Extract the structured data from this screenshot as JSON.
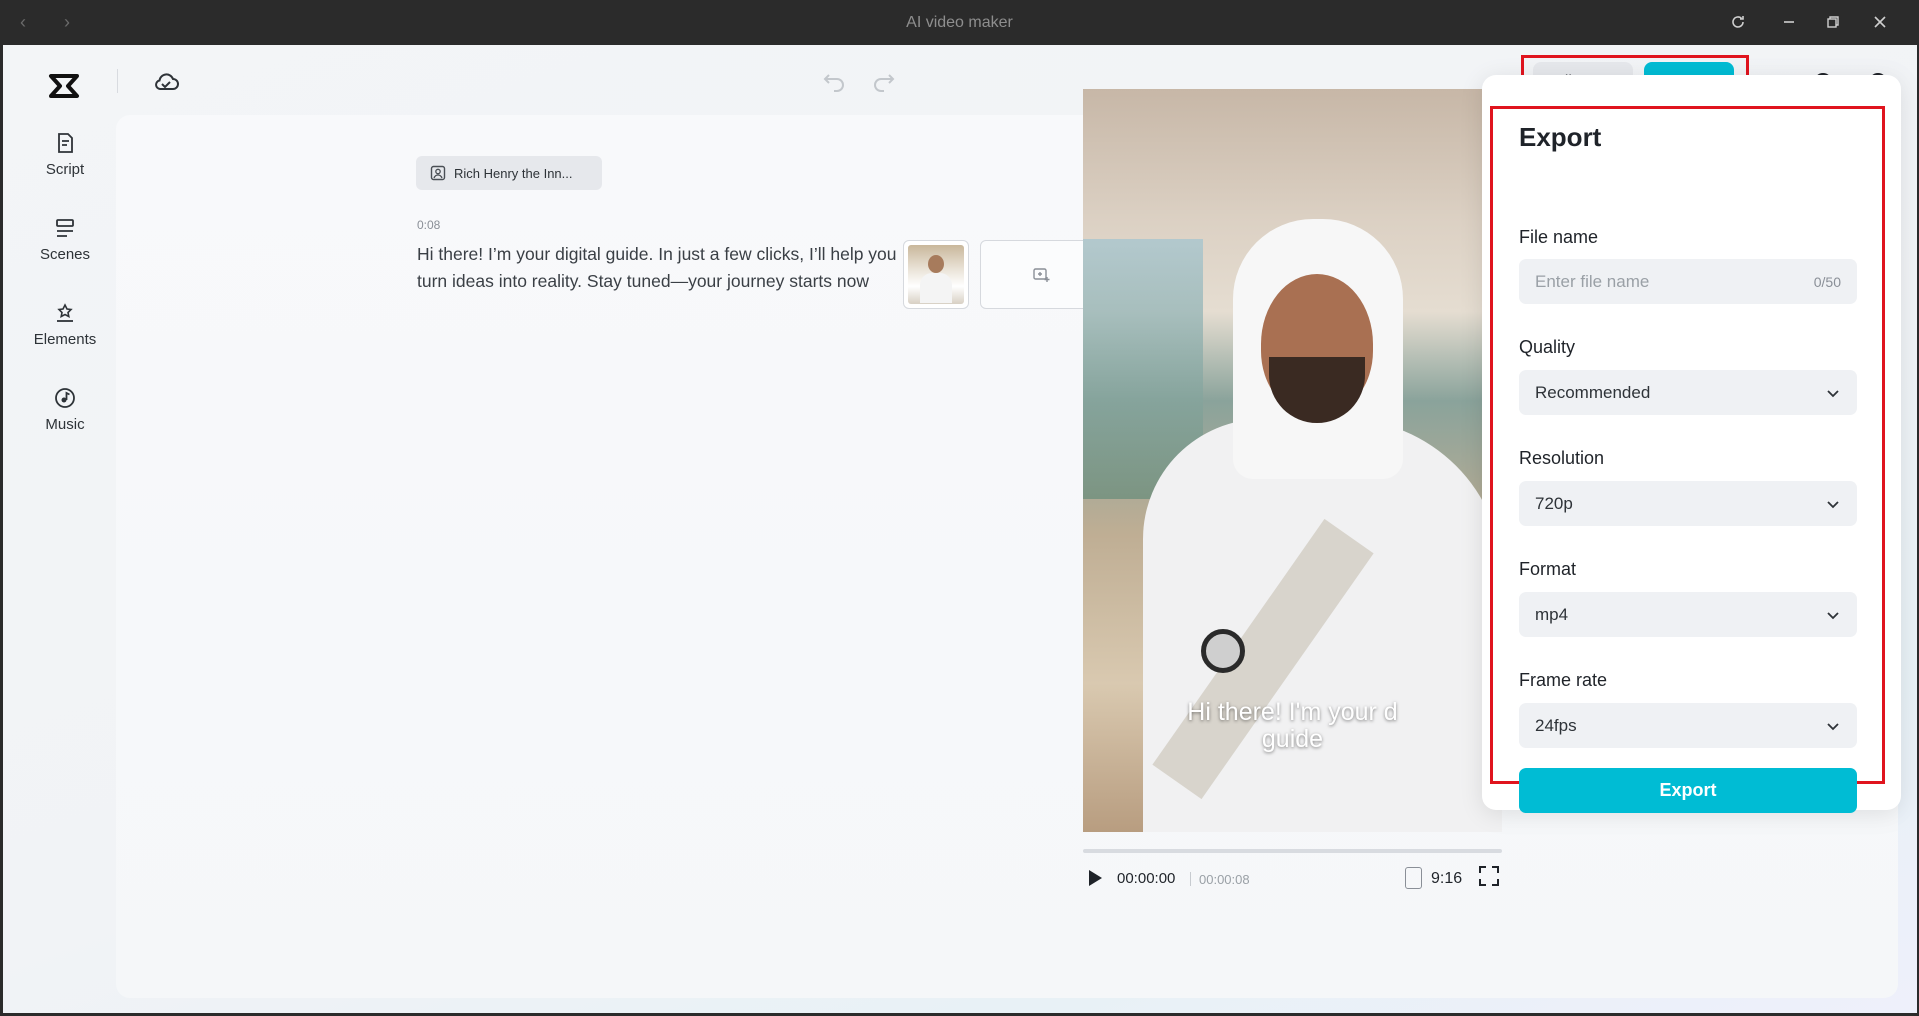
{
  "window": {
    "title": "AI video maker"
  },
  "toolbar": {
    "edit_more_label": "Edit more",
    "export_label": "Export"
  },
  "sidebar": {
    "items": [
      {
        "label": "Script",
        "icon": "script-icon"
      },
      {
        "label": "Scenes",
        "icon": "scenes-icon"
      },
      {
        "label": "Elements",
        "icon": "elements-icon"
      },
      {
        "label": "Music",
        "icon": "music-icon"
      }
    ]
  },
  "script": {
    "avatar_name": "Rich Henry the Inn...",
    "timecode": "0:08",
    "text": "Hi there! I’m your digital guide. In just a few clicks, I’ll help you turn ideas into reality. Stay tuned—your journey starts now"
  },
  "preview": {
    "subtitle_line1": "Hi there! I'm your d",
    "subtitle_line2": "guide",
    "current_time": "00:00:00",
    "total_time": "00:00:08",
    "aspect_ratio": "9:16",
    "progress_fraction": 0
  },
  "export_panel": {
    "title": "Export",
    "file_name": {
      "label": "File name",
      "placeholder": "Enter file name",
      "counter": "0/50"
    },
    "quality": {
      "label": "Quality",
      "value": "Recommended"
    },
    "resolution": {
      "label": "Resolution",
      "value": "720p"
    },
    "format": {
      "label": "Format",
      "value": "mp4"
    },
    "frame_rate": {
      "label": "Frame rate",
      "value": "24fps"
    },
    "export_button": "Export"
  },
  "colors": {
    "accent": "#00bcd4",
    "highlight": "#e0141e"
  }
}
